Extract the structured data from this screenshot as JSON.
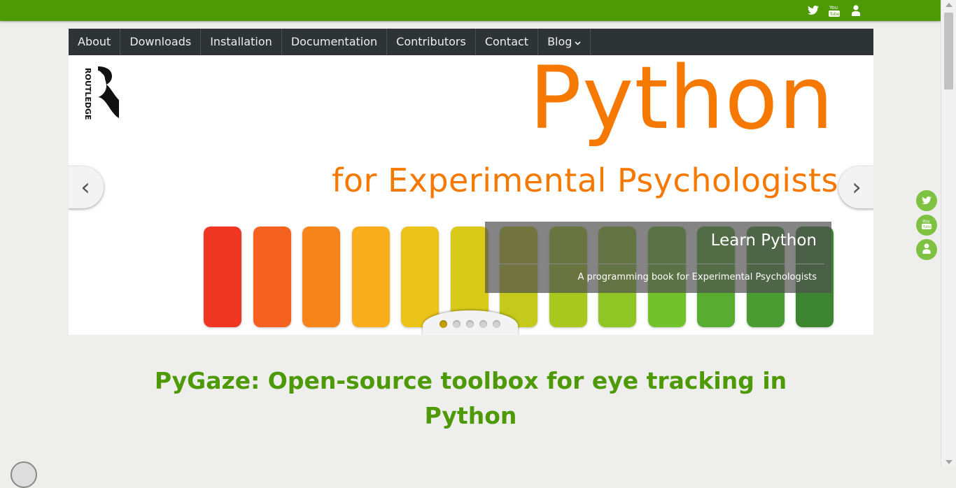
{
  "topbar": {
    "icons": [
      "twitter-icon",
      "youtube-icon",
      "user-icon"
    ]
  },
  "nav": {
    "items": [
      {
        "label": "About"
      },
      {
        "label": "Downloads"
      },
      {
        "label": "Installation"
      },
      {
        "label": "Documentation"
      },
      {
        "label": "Contributors"
      },
      {
        "label": "Contact"
      },
      {
        "label": "Blog"
      }
    ]
  },
  "slider": {
    "title": "Python",
    "subtitle": "for Experimental Psychologists",
    "logo_text": "ROUTLEDGE",
    "caption_title": "Learn Python",
    "caption_text": "A programming book for Experimental Psychologists",
    "prev_icon": "‹",
    "next_icon": "›",
    "active_slide": 1,
    "slide_count": 5,
    "bar_colors": [
      "#ef3622",
      "#f5611f",
      "#f5851a",
      "#f9ad1a",
      "#ecc318",
      "#d9c919",
      "#c4c91b",
      "#a9c81e",
      "#8fc625",
      "#72c22c",
      "#58ad31",
      "#4a9b32",
      "#3d8530"
    ]
  },
  "main": {
    "headline": "PyGaze: Open-source toolbox for eye tracking in Python"
  },
  "colors": {
    "brand": "#4e9a06",
    "accent": "#f57900",
    "nav_bg": "#2e3436"
  }
}
